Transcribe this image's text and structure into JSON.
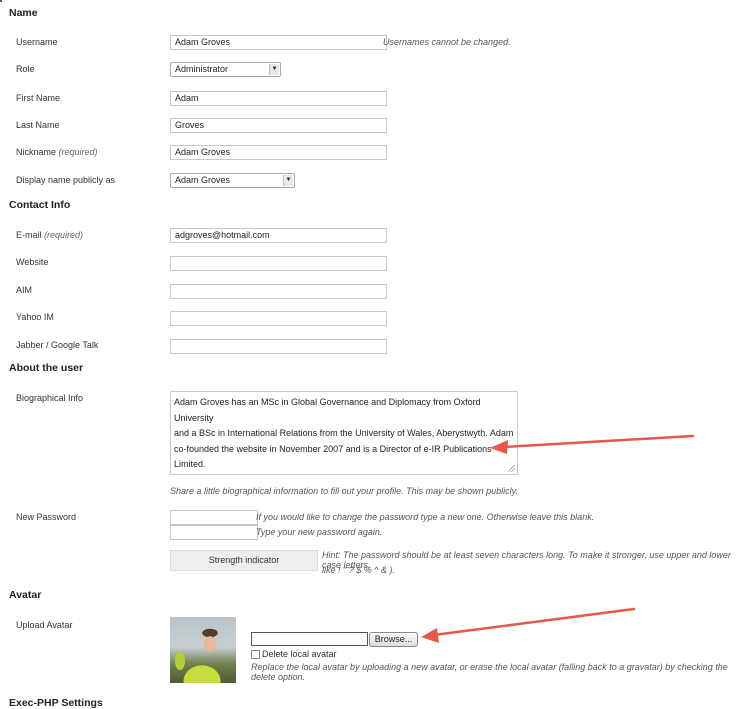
{
  "sections": {
    "name": "Name",
    "contact": "Contact Info",
    "about": "About the user",
    "avatar": "Avatar",
    "exec_php": "Exec-PHP Settings"
  },
  "name": {
    "username_label": "Username",
    "username_value": "Adam Groves",
    "username_hint": "Usernames cannot be changed.",
    "role_label": "Role",
    "role_value": "Administrator",
    "first_name_label": "First Name",
    "first_name_value": "Adam",
    "last_name_label": "Last Name",
    "last_name_value": "Groves",
    "nickname_label": "Nickname",
    "nickname_required": "(required)",
    "nickname_value": "Adam Groves",
    "display_label": "Display name publicly as",
    "display_value": "Adam Groves"
  },
  "contact": {
    "email_label": "E-mail",
    "email_required": "(required)",
    "email_value": "adgroves@hotmail.com",
    "website_label": "Website",
    "website_value": "",
    "aim_label": "AIM",
    "aim_value": "",
    "yahoo_label": "Yahoo IM",
    "yahoo_value": "",
    "jabber_label": "Jabber / Google Talk",
    "jabber_value": ""
  },
  "about": {
    "bio_label": "Biographical Info",
    "bio_lines": [
      "Adam Groves has an MSc in Global Governance and Diplomacy from Oxford University",
      "and a BSc in International Relations from the University of Wales, Aberystwyth. Adam",
      "co-founded the website in November 2007 and is a Director of e-IR Publications Limited."
    ],
    "bio_hint": "Share a little biographical information to fill out your profile. This may be shown publicly.",
    "password_label": "New Password",
    "password_hint_1": "If you would like to change the password type a new one. Otherwise leave this blank.",
    "password_hint_2": "Type your new password again.",
    "strength_label": "Strength indicator",
    "strength_hint_1": "Hint: The password should be at least seven characters long. To make it stronger, use upper and lower case letters,",
    "strength_hint_2": "like ! \" ? $ % ^ & )."
  },
  "avatar": {
    "upload_label": "Upload Avatar",
    "browse_label": "Browse...",
    "delete_label": "Delete local avatar",
    "avatar_hint": "Replace the local avatar by uploading a new avatar, or erase the local avatar (falling back to a gravatar) by checking the delete option."
  },
  "icons": {
    "select_arrow": "chevron-down-icon",
    "annotation_arrow": "arrow-left-icon"
  },
  "colors": {
    "annotation": "#e8574a"
  }
}
